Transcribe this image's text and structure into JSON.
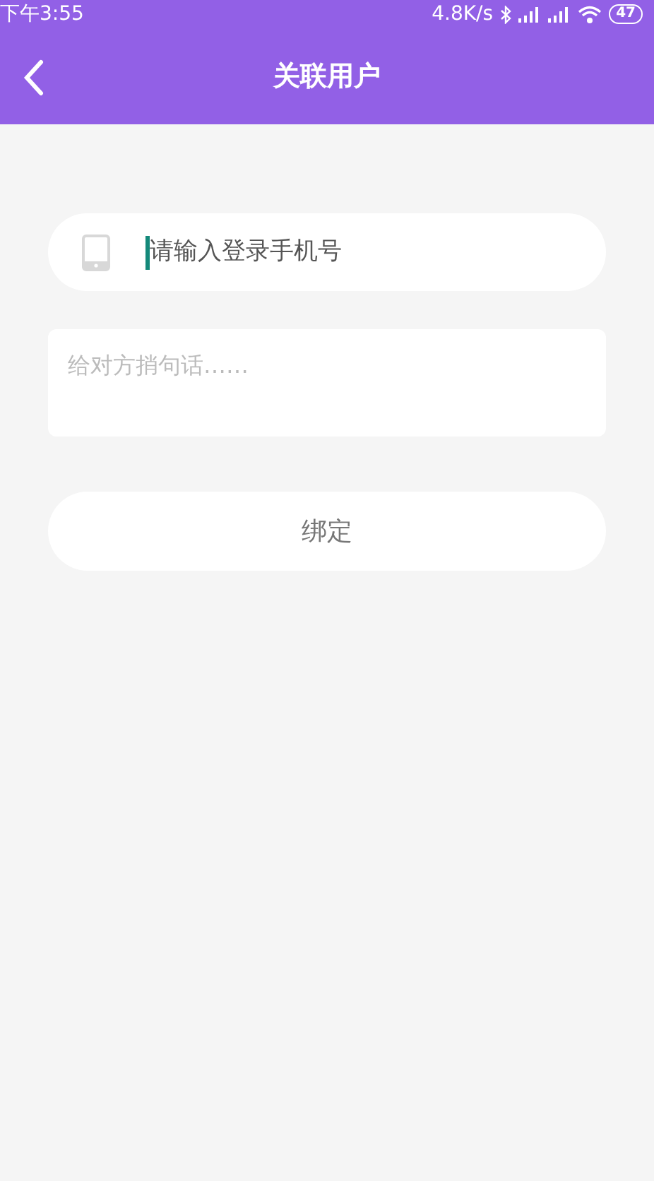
{
  "status_bar": {
    "time": "下午3:55",
    "speed": "4.8K/s",
    "battery": "47"
  },
  "header": {
    "title": "关联用户"
  },
  "phone_field": {
    "placeholder": "请输入登录手机号",
    "focused": true
  },
  "message_field": {
    "placeholder": "给对方捎句话……"
  },
  "bind_button": {
    "label": "绑定"
  }
}
